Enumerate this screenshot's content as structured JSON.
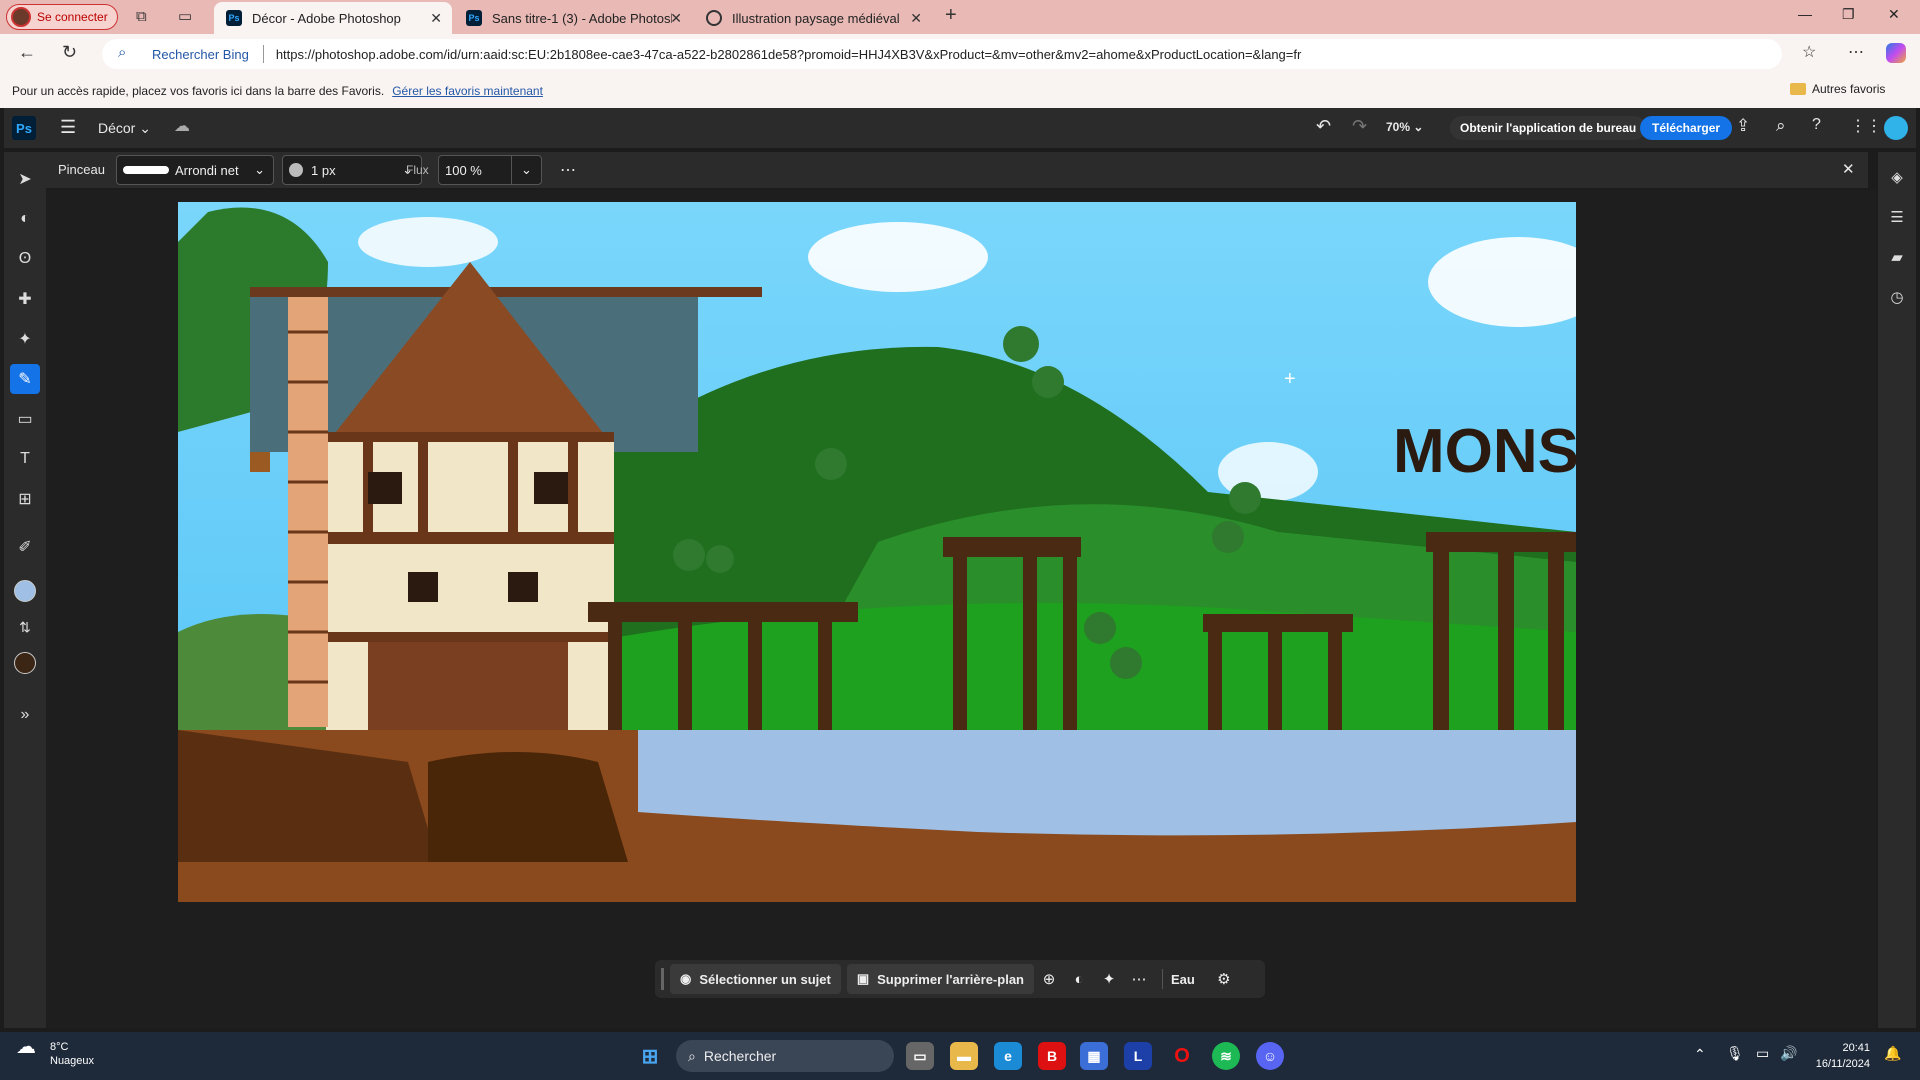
{
  "browser": {
    "signin_label": "Se connecter",
    "tabs": [
      {
        "title": "Décor - Adobe Photoshop",
        "favicon": "Ps"
      },
      {
        "title": "Sans titre-1 (3) - Adobe Photosho",
        "favicon": "Ps"
      },
      {
        "title": "Illustration paysage médiéval",
        "favicon": "openai-icon"
      }
    ],
    "new_tab": "+",
    "search_label": "Rechercher Bing",
    "url": "https://photoshop.adobe.com/id/urn:aaid:sc:EU:2b1808ee-cae3-47ca-a522-b2802861de58?promoid=HHJ4XB3V&xProduct=&mv=other&mv2=ahome&xProductLocation=&lang=fr",
    "favbar_text": "Pour un accès rapide, placez vos favoris ici dans la barre des Favoris.",
    "favbar_link": "Gérer les favoris maintenant",
    "other_favorites": "Autres favoris"
  },
  "photoshop": {
    "logo": "Ps",
    "document_name": "Décor",
    "zoom": "70%",
    "desktop_app": "Obtenir l'application de bureau",
    "download": "Télécharger",
    "options": {
      "tool_name": "Pinceau",
      "brush": "Arrondi net",
      "size": "1 px",
      "flow_label": "Flux",
      "flow_value": "100 %"
    },
    "context_bar": {
      "select_subject": "Sélectionner un sujet",
      "remove_background": "Supprimer l'arrière-plan",
      "layer_name": "Eau"
    },
    "canvas_text": "MONS TRE",
    "colors": {
      "foreground": "#9fc0e4",
      "background": "#3b2514",
      "accent": "#1473e6"
    }
  },
  "taskbar": {
    "weather_temp": "8°C",
    "weather_desc": "Nuageux",
    "search": "Rechercher",
    "time": "20:41",
    "date": "16/11/2024"
  }
}
